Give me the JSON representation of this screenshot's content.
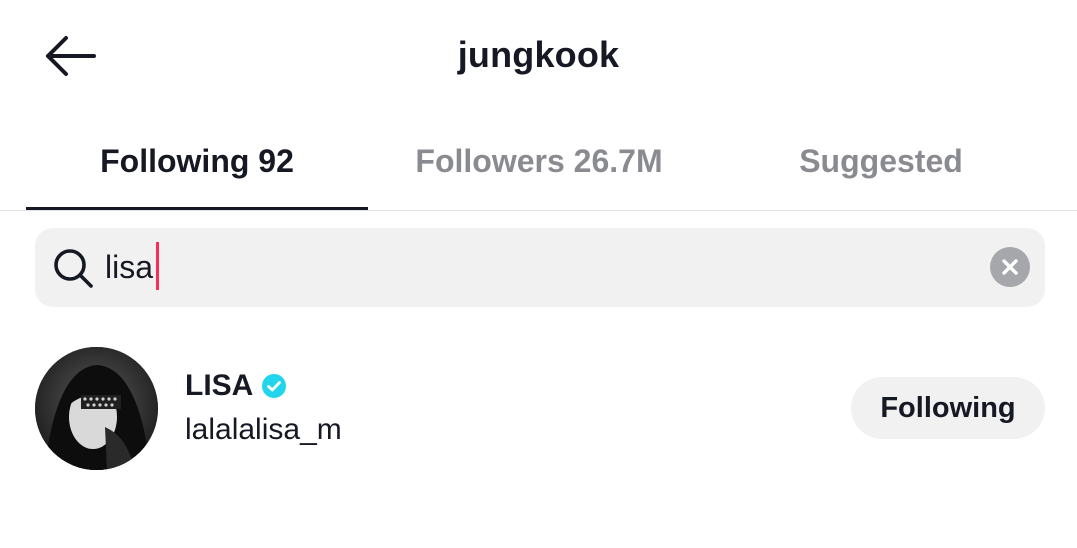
{
  "header": {
    "title": "jungkook",
    "back_icon": "arrow-left-icon"
  },
  "tabs": [
    {
      "label": "Following 92",
      "active": true
    },
    {
      "label": "Followers 26.7M",
      "active": false
    },
    {
      "label": "Suggested",
      "active": false
    }
  ],
  "search": {
    "value": "lisa",
    "icon": "search-icon",
    "clear_icon": "clear-x-icon",
    "caret_color": "#fe2c55"
  },
  "results": [
    {
      "display_name": "LISA",
      "verified": true,
      "username": "lalalalisa_m",
      "button_label": "Following"
    }
  ],
  "colors": {
    "text_primary": "#161823",
    "text_secondary": "#8a8b91",
    "verified_badge": "#20d5ec",
    "surface": "#f1f1f2"
  }
}
